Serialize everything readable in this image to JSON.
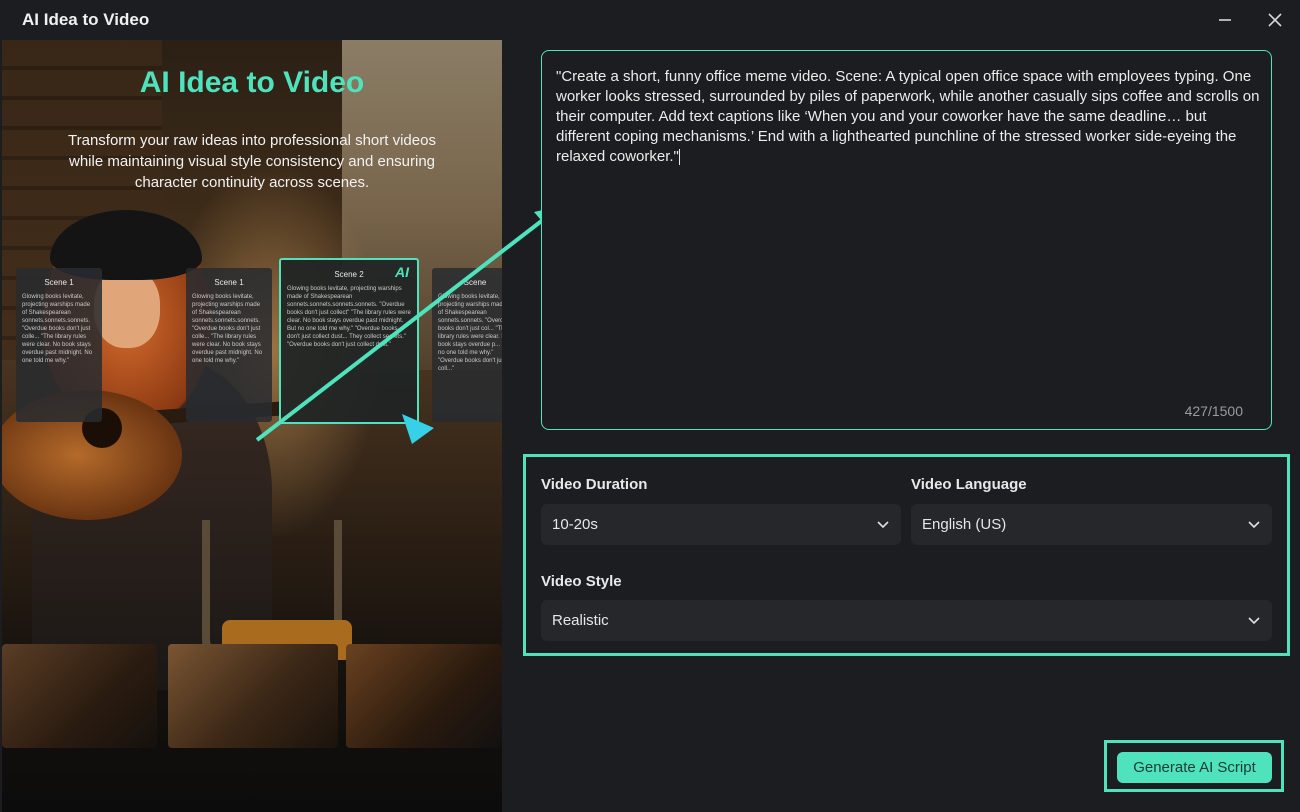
{
  "window": {
    "title": "AI Idea to Video"
  },
  "hero": {
    "title": "AI Idea to Video",
    "description": "Transform your raw ideas into professional short videos while maintaining visual style consistency and ensuring character continuity across scenes."
  },
  "scene_cards": [
    {
      "title": "Scene 1",
      "text": "Glowing books levitate, projecting warships made of Shakespearean sonnets.sonnets.sonnets. \"Overdue books don't just colle... \"The library rules were clear. No book stays overdue past midnight. No one told me why.\""
    },
    {
      "title": "Scene 2",
      "badge": "AI",
      "text": "Glowing books levitate, projecting warships made of Shakespearean sonnets.sonnets.sonnets.sonnets. \"Overdue books don't just collect\" \"The library rules were clear. No book stays overdue past midnight. But no one told me why.\" \"Overdue books don't just collect dust... They collect secrets.\" \"Overdue books don't just collect dust.\""
    },
    {
      "title": "Scene",
      "text": "Glowing books levitate, projecting warships made of Shakespearean sonnets.sonnets. \"Overdue books don't just col... \"The library rules were clear. No book stays overdue p... But no one told me why.\" \"Overdue books don't just coll...\""
    }
  ],
  "prompt": {
    "text": "\"Create a short, funny office meme video. Scene: A typical open office space with employees typing. One worker looks stressed, surrounded by piles of paperwork, while another casually sips coffee and scrolls on their computer. Add text captions like ‘When you and your coworker have the same deadline… but different coping mechanisms.’ End with a lighthearted punchline of the stressed worker side-eyeing the relaxed coworker.\"",
    "count": "427/1500"
  },
  "settings": {
    "duration_label": "Video Duration",
    "duration_value": "10-20s",
    "language_label": "Video Language",
    "language_value": "English (US)",
    "style_label": "Video Style",
    "style_value": "Realistic"
  },
  "actions": {
    "generate": "Generate AI Script"
  },
  "colors": {
    "accent": "#4fe3bd",
    "background": "#1c1d20",
    "field": "#26272b"
  }
}
